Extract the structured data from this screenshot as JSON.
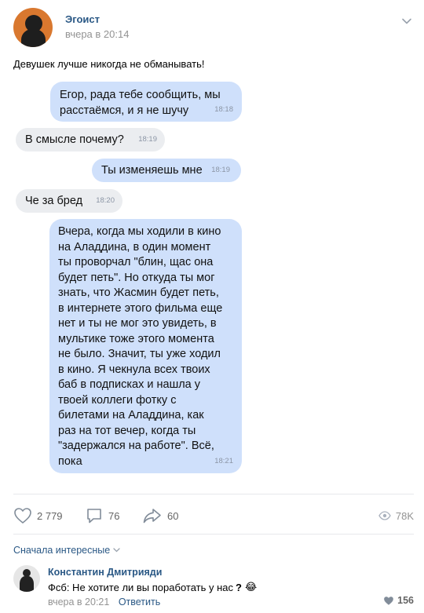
{
  "post": {
    "author": "Эгоист",
    "time": "вчера в 20:14",
    "text": "Девушек лучше никогда не обманывать!"
  },
  "messages": [
    {
      "lines": [
        "Егор, рада тебе сообщить, мы",
        "расстаёмся, и я не шучу"
      ],
      "time": "18:18",
      "direction": "out"
    },
    {
      "lines": [
        "В смысле почему?"
      ],
      "time": "18:19",
      "direction": "in"
    },
    {
      "lines": [
        "Ты изменяешь мне"
      ],
      "time": "18:19",
      "direction": "out"
    },
    {
      "lines": [
        "Че за бред"
      ],
      "time": "18:20",
      "direction": "in"
    },
    {
      "lines": [
        "Вчера, когда мы ходили в кино",
        "на Аладдина, в один момент",
        "ты проворчал \"блин, щас она",
        "будет петь\". Но откуда ты мог",
        "знать, что Жасмин будет петь,",
        "в интернете этого фильма еще",
        "нет и ты не мог это увидеть, в",
        "мультике тоже этого момента",
        "не было. Значит, ты уже ходил",
        "в кино. Я чекнула всех твоих",
        "баб в подписках и нашла у",
        "твоей коллеги фотку с",
        "билетами на Аладдина, как",
        "раз на тот вечер, когда ты",
        "\"задержался на работе\". Всё,",
        "пока"
      ],
      "time": "18:21",
      "direction": "out"
    }
  ],
  "actions": {
    "likes": "2 779",
    "comments": "76",
    "shares": "60",
    "views": "78K"
  },
  "comments_sort": "Сначала интересные",
  "comment": {
    "author": "Константин Дмитрияди",
    "text": "Фсб: Не хотите ли вы поработать у нас",
    "question_mark": "?",
    "emoji": "😂",
    "time": "вчера в 20:21",
    "reply_label": "Ответить",
    "likes": "156"
  },
  "colors": {
    "link": "#2a5885",
    "outgoing_bubble": "#cfe0fb",
    "incoming_bubble": "#ebedf0",
    "avatar_bg": "#d9782f"
  }
}
